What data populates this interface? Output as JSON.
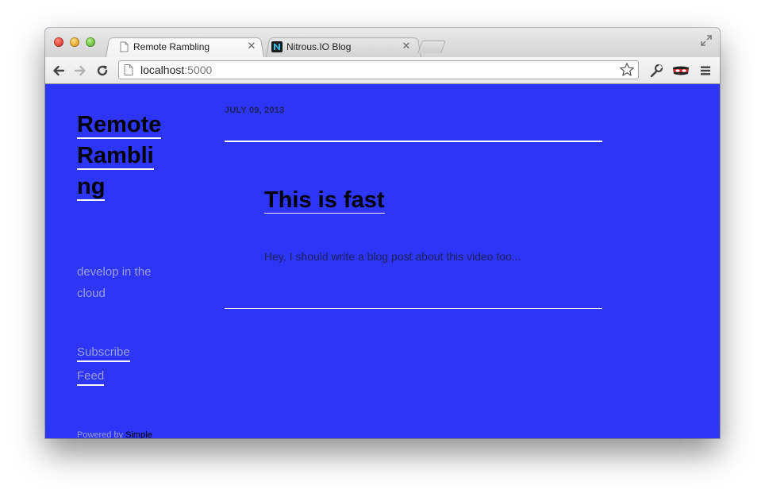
{
  "browser": {
    "tabs": [
      {
        "label": "Remote Rambling",
        "active": true,
        "favicon": "page-icon"
      },
      {
        "label": "Nitrous.IO Blog",
        "active": false,
        "favicon": "nitrous-logo-icon"
      }
    ],
    "address": {
      "host": "localhost",
      "port": ":5000"
    },
    "toolbar_icons": [
      "back-icon",
      "forward-icon",
      "reload-icon",
      "star-icon",
      "wrench-icon",
      "mask-extension-icon",
      "menu-icon"
    ]
  },
  "site": {
    "title": "Remote Rambling",
    "tagline": "develop in the cloud",
    "links": {
      "subscribe": "Subscribe",
      "feed": "Feed"
    },
    "footer": {
      "prefix": "Powered by ",
      "brand": "Simple"
    },
    "colors": {
      "background": "#2d35f6",
      "rule": "#ffffff",
      "muted_text": "#9a9ee0"
    }
  },
  "post": {
    "date": "JULY 09, 2013",
    "title": "This is fast",
    "excerpt": "Hey, I should write a blog post about this video too..."
  }
}
